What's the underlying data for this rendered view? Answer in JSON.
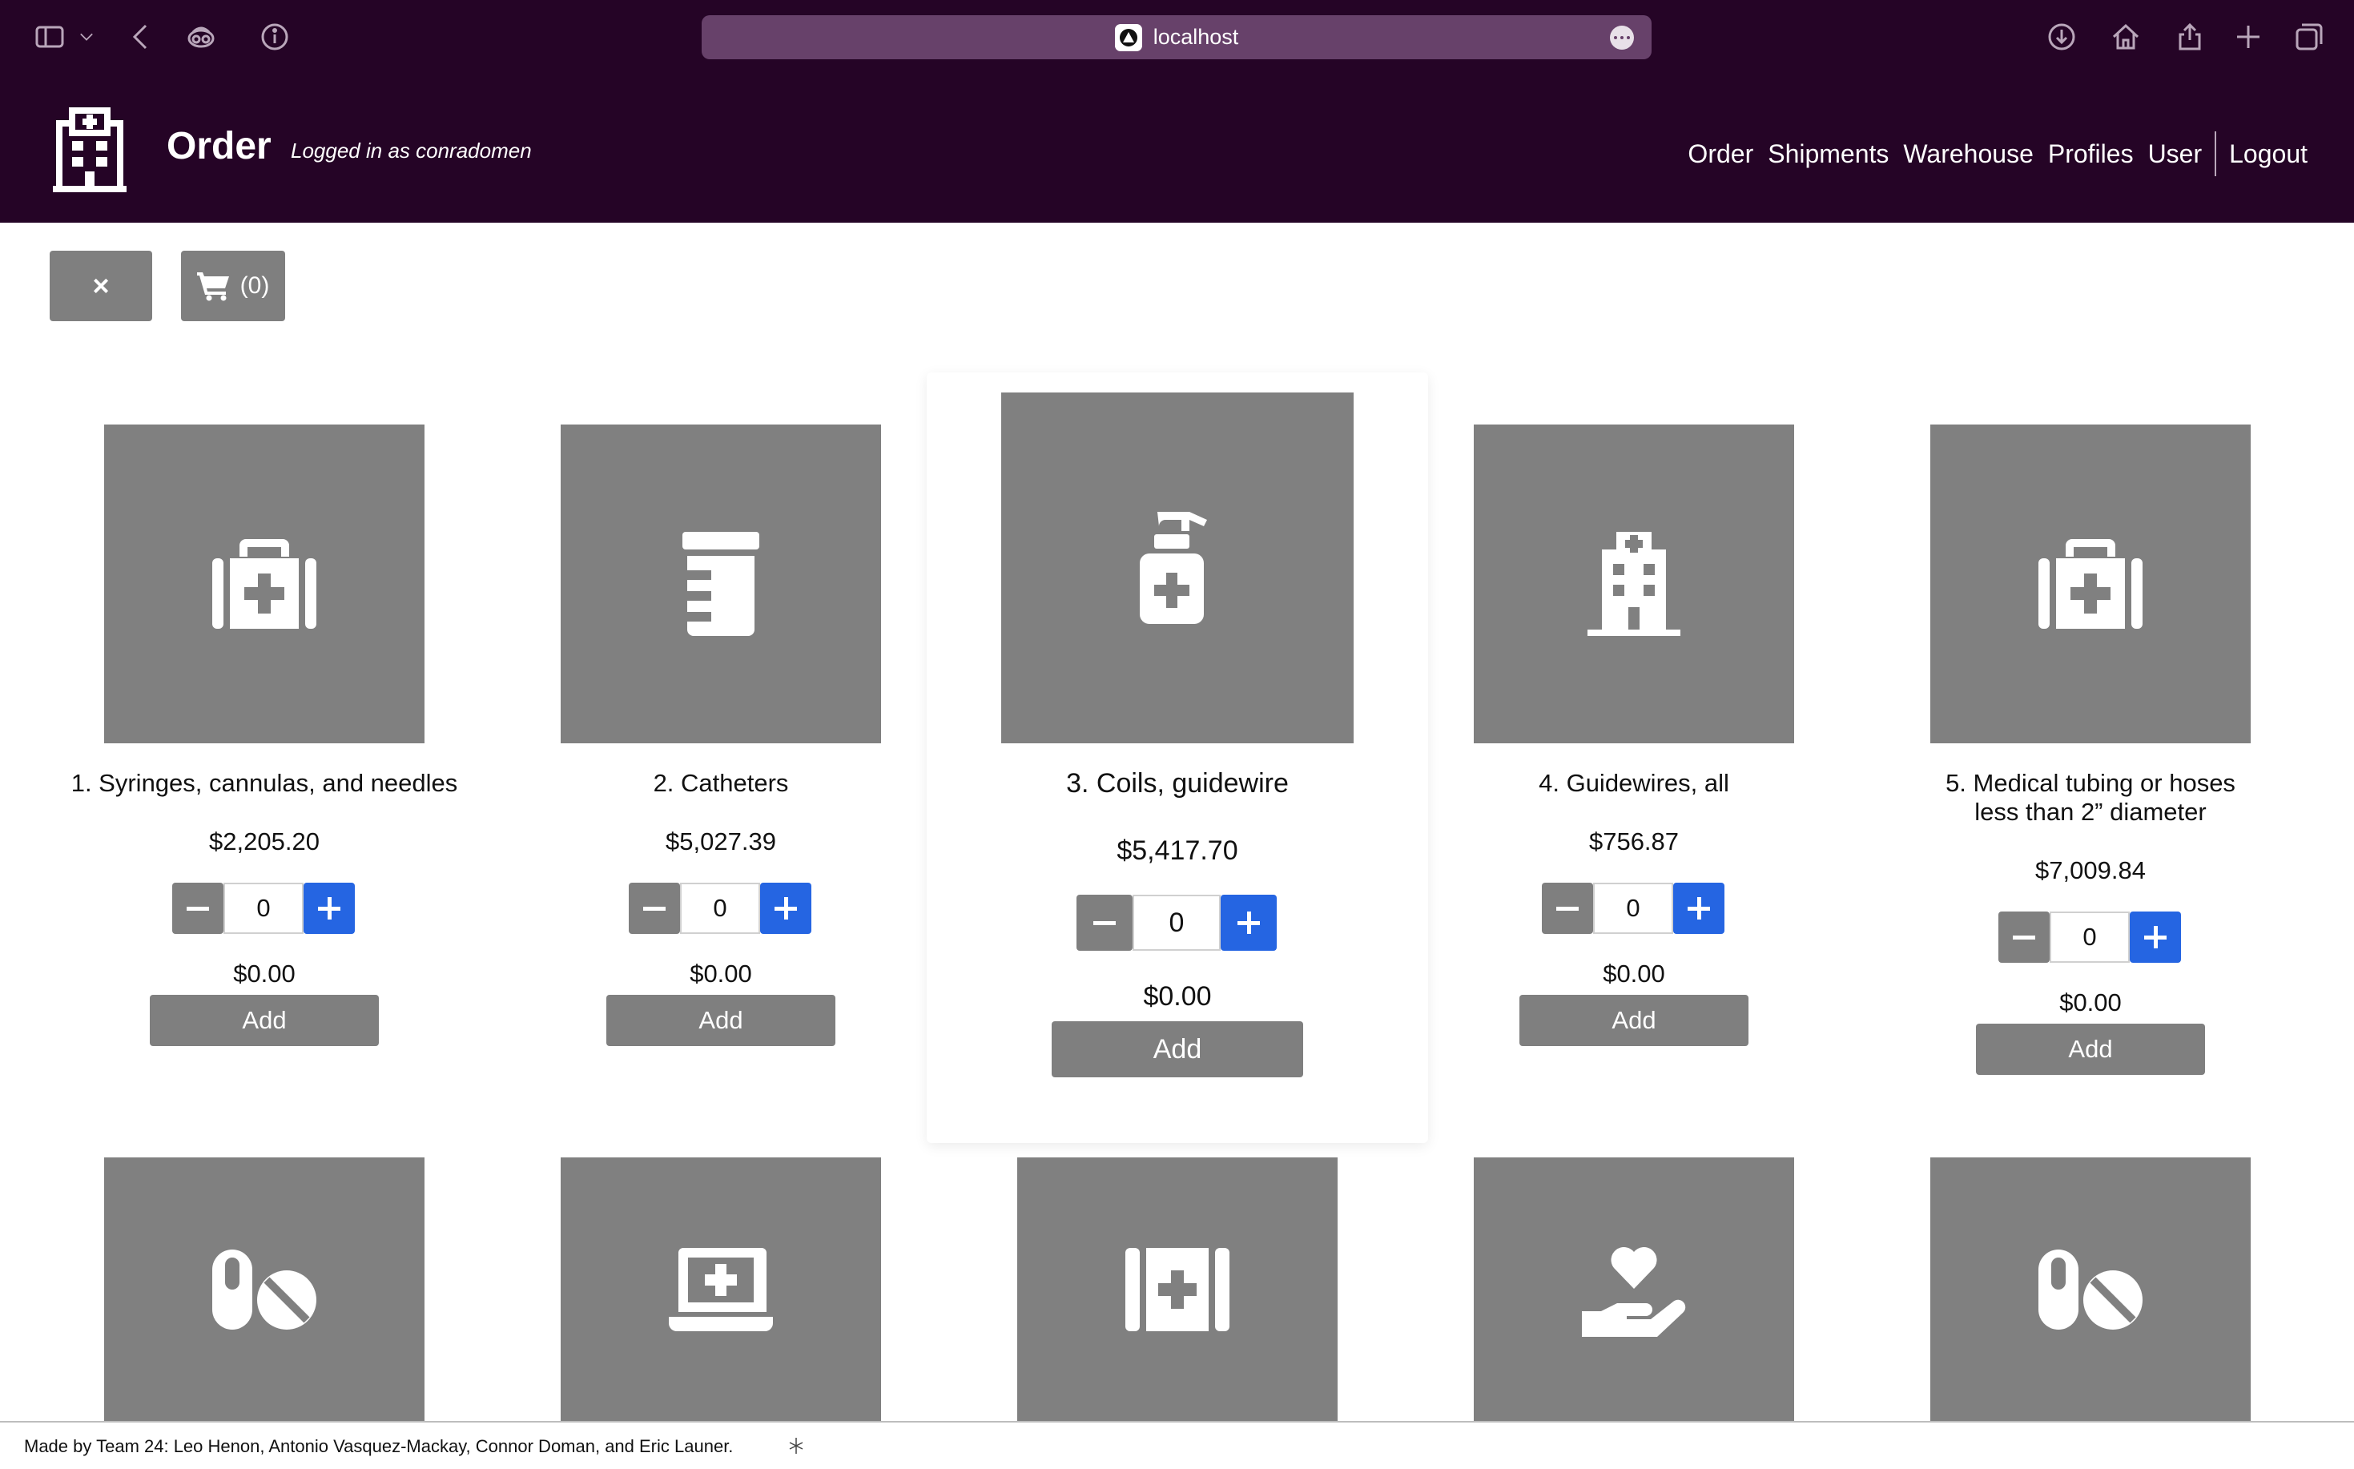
{
  "browser": {
    "url": "localhost",
    "icons": [
      "sidebar-icon",
      "chevron-down-icon",
      "back-icon",
      "privacy-icon",
      "info-icon",
      "download-icon",
      "home-icon",
      "share-icon",
      "plus-icon",
      "tabs-icon"
    ]
  },
  "header": {
    "title": "Order",
    "login_status": "Logged in as conradomen",
    "nav": [
      "Order",
      "Shipments",
      "Warehouse",
      "Profiles",
      "User",
      "Logout"
    ]
  },
  "toolbar": {
    "close_label": "×",
    "cart_count": "(0)"
  },
  "products": [
    {
      "name": "1. Syringes, cannulas, and needles",
      "price": "$2,205.20",
      "quantity": "0",
      "total": "$0.00",
      "add_label": "Add",
      "icon": "medkit-icon"
    },
    {
      "name": "2. Catheters",
      "price": "$5,027.39",
      "quantity": "0",
      "total": "$0.00",
      "add_label": "Add",
      "icon": "prescription-bottle-icon"
    },
    {
      "name": "3. Coils, guidewire",
      "price": "$5,417.70",
      "quantity": "0",
      "total": "$0.00",
      "add_label": "Add",
      "icon": "pump-medical-icon"
    },
    {
      "name": "4. Guidewires, all",
      "price": "$756.87",
      "quantity": "0",
      "total": "$0.00",
      "add_label": "Add",
      "icon": "hospital-icon"
    },
    {
      "name": "5. Medical tubing or hoses less than 2” diameter",
      "price": "$7,009.84",
      "quantity": "0",
      "total": "$0.00",
      "add_label": "Add",
      "icon": "medkit-icon"
    }
  ],
  "row2_icons": [
    "pills-icon",
    "laptop-medical-icon",
    "first-aid-icon",
    "hand-holding-heart-icon",
    "pills-icon"
  ],
  "footer": {
    "text": "Made by Team 24: Leo Henon, Antonio Vasquez-Mackay, Connor Doman, and Eric Launer."
  },
  "colors": {
    "header_bg": "#250426",
    "url_bar_bg": "#67416a",
    "button_gray": "#7f7f7f",
    "plus_blue": "#2565e2",
    "image_gray": "#808080"
  }
}
